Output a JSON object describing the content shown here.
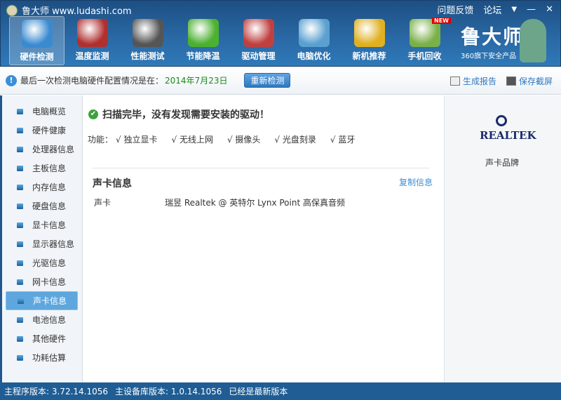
{
  "window": {
    "title": "鲁大师 www.ludashi.com",
    "feedback": "问题反馈",
    "forum": "论坛",
    "menu": "▼",
    "minimize": "—",
    "close": "✕"
  },
  "toolbar": [
    {
      "label": "硬件检测",
      "icon": "monitor-magnifier-icon",
      "color": "#3a8ad0"
    },
    {
      "label": "温度监测",
      "icon": "thermometer-icon",
      "color": "#b03030"
    },
    {
      "label": "性能测试",
      "icon": "speedometer-icon",
      "color": "#555"
    },
    {
      "label": "节能降温",
      "icon": "clover-fan-icon",
      "color": "#4cb030"
    },
    {
      "label": "驱动管理",
      "icon": "driver-box-icon",
      "color": "#c04040"
    },
    {
      "label": "电脑优化",
      "icon": "magic-monitor-icon",
      "color": "#5aa0d0"
    },
    {
      "label": "新机推荐",
      "icon": "award-monitor-icon",
      "color": "#e0b020"
    },
    {
      "label": "手机回收",
      "icon": "phone-recycle-icon",
      "color": "#7ab048",
      "badge": "NEW"
    }
  ],
  "brand": {
    "name": "鲁大师",
    "tagline": "360旗下安全产品"
  },
  "infobar": {
    "text": "最后一次检测电脑硬件配置情况是在：",
    "date": "2014年7月23日",
    "rescan": "重新检测",
    "report": "生成报告",
    "screenshot": "保存截屏"
  },
  "sidebar": [
    "电脑概览",
    "硬件健康",
    "处理器信息",
    "主板信息",
    "内存信息",
    "硬盘信息",
    "显卡信息",
    "显示器信息",
    "光驱信息",
    "网卡信息",
    "声卡信息",
    "电池信息",
    "其他硬件",
    "功耗估算"
  ],
  "main": {
    "headline": "扫描完毕，没有发现需要安装的驱动！",
    "features_label": "功能：",
    "features": [
      "√ 独立显卡",
      "√ 无线上网",
      "√ 摄像头",
      "√ 光盘刻录",
      "√ 蓝牙"
    ],
    "section": "声卡信息",
    "copy": "复制信息",
    "row": {
      "key": "声卡",
      "value": "瑞昱 Realtek @ 英特尔 Lynx Point 高保真音频"
    }
  },
  "right": {
    "logo": "REALTEK",
    "label": "声卡品牌"
  },
  "status": {
    "main_version": "主程序版本: 3.72.14.1056",
    "db_version": "主设备库版本: 1.0.14.1056",
    "state": "已经是最新版本"
  }
}
